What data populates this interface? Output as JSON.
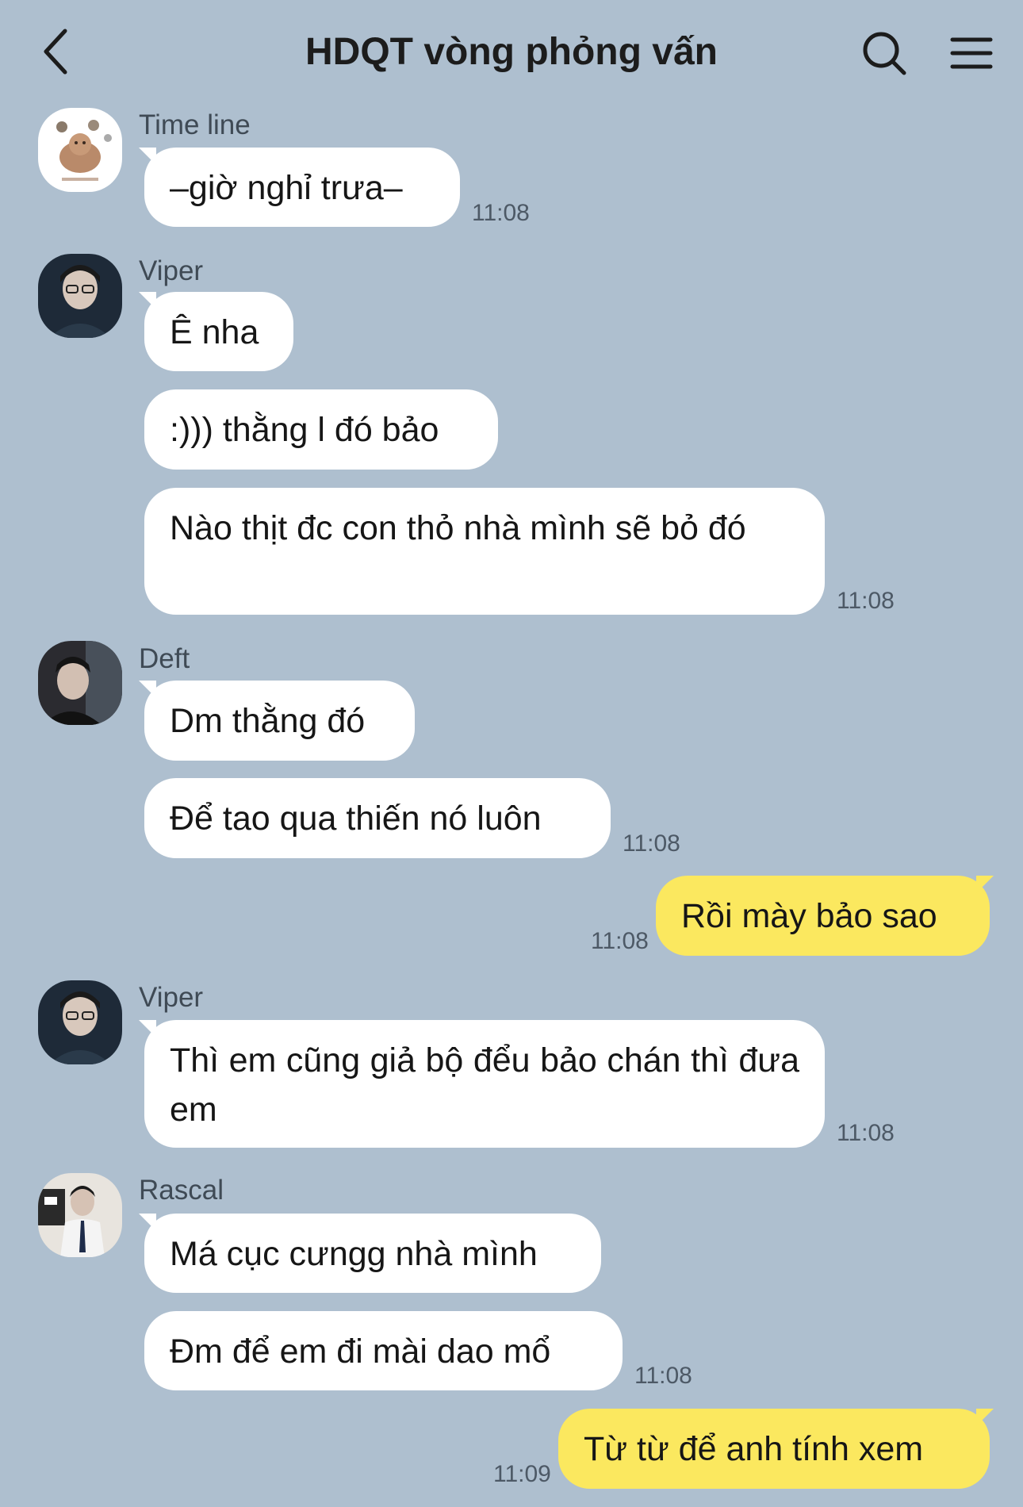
{
  "header": {
    "title": "HDQT vòng phỏng vấn",
    "back_icon": "chevron-left-icon",
    "search_icon": "search-icon",
    "menu_icon": "hamburger-menu-icon"
  },
  "colors": {
    "background": "#aebfcf",
    "incoming_bubble": "#ffffff",
    "outgoing_bubble": "#fbe85f"
  },
  "messages": [
    {
      "sender": "Time line",
      "texts": [
        "–giờ nghỉ trưa–"
      ],
      "time": "11:08"
    },
    {
      "sender": "Viper",
      "texts": [
        "Ê nha",
        ":))) thằng l đó bảo",
        "Nào thịt đc con thỏ nhà mình sẽ bỏ đó"
      ],
      "time": "11:08"
    },
    {
      "sender": "Deft",
      "texts": [
        "Dm thằng đó",
        "Để tao qua thiến nó luôn"
      ],
      "time": "11:08"
    },
    {
      "sender": "me",
      "texts": [
        "Rồi mày bảo sao"
      ],
      "time": "11:08"
    },
    {
      "sender": "Viper",
      "texts": [
        "Thì em cũng giả bộ đểu bảo chán thì đưa em"
      ],
      "time": "11:08"
    },
    {
      "sender": "Rascal",
      "texts": [
        "Má cục cưngg nhà mình",
        "Đm để em đi mài dao mổ"
      ],
      "time": "11:08"
    },
    {
      "sender": "me",
      "texts": [
        "Từ từ để anh tính xem"
      ],
      "time": "11:09"
    }
  ]
}
